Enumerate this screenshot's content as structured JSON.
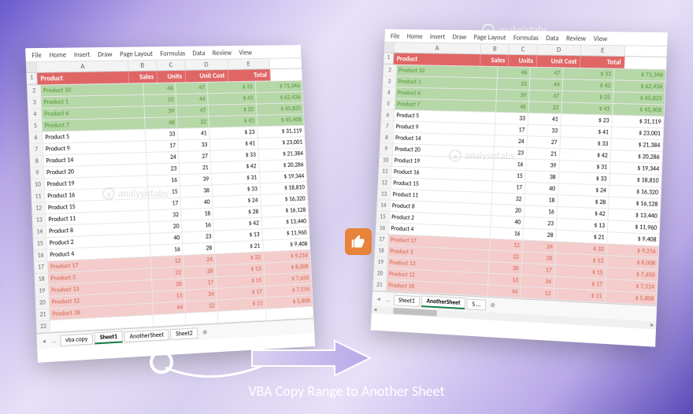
{
  "caption": "VBA Copy Range to Another Sheet",
  "watermark": "analysistabs",
  "ribbon_tabs": [
    "File",
    "Home",
    "Insert",
    "Draw",
    "Page Layout",
    "Formulas",
    "Data",
    "Review",
    "View"
  ],
  "col_letters": [
    "",
    "A",
    "B",
    "C",
    "D",
    "E"
  ],
  "header": {
    "product": "Product",
    "sales": "Sales",
    "units": "Units",
    "unitcost": "Unit Cost",
    "total": "Total"
  },
  "left": {
    "rows": [
      {
        "n": 2,
        "p": "Product 10",
        "s": 46,
        "u": 47,
        "c": "$   33",
        "t": "$   71,346",
        "cls": "g1"
      },
      {
        "n": 3,
        "p": "Product 1",
        "s": 33,
        "u": 44,
        "c": "$   43",
        "t": "$   62,436",
        "cls": "g1"
      },
      {
        "n": 4,
        "p": "Product 6",
        "s": 39,
        "u": 47,
        "c": "$   25",
        "t": "$   45,825",
        "cls": "g1"
      },
      {
        "n": 5,
        "p": "Product 7",
        "s": 48,
        "u": 22,
        "c": "$   43",
        "t": "$   45,408",
        "cls": "g1"
      },
      {
        "n": 6,
        "p": "Product 5",
        "s": 33,
        "u": 41,
        "c": "$   23",
        "t": "$   31,119",
        "cls": ""
      },
      {
        "n": 7,
        "p": "Product 9",
        "s": 17,
        "u": 33,
        "c": "$   41",
        "t": "$   23,001",
        "cls": ""
      },
      {
        "n": 8,
        "p": "Product 14",
        "s": 24,
        "u": 27,
        "c": "$   33",
        "t": "$   21,384",
        "cls": ""
      },
      {
        "n": 9,
        "p": "Product 20",
        "s": 23,
        "u": 21,
        "c": "$   42",
        "t": "$   20,286",
        "cls": ""
      },
      {
        "n": 10,
        "p": "Product 19",
        "s": 16,
        "u": 39,
        "c": "$   31",
        "t": "$   19,344",
        "cls": ""
      },
      {
        "n": 11,
        "p": "Product 16",
        "s": 15,
        "u": 38,
        "c": "$   33",
        "t": "$   18,810",
        "cls": ""
      },
      {
        "n": 12,
        "p": "Product 15",
        "s": 17,
        "u": 40,
        "c": "$   24",
        "t": "$   16,320",
        "cls": ""
      },
      {
        "n": 13,
        "p": "Product 11",
        "s": 32,
        "u": 18,
        "c": "$   28",
        "t": "$   16,128",
        "cls": ""
      },
      {
        "n": 14,
        "p": "Product 8",
        "s": 20,
        "u": 16,
        "c": "$   42",
        "t": "$   13,440",
        "cls": ""
      },
      {
        "n": 15,
        "p": "Product 2",
        "s": 40,
        "u": 23,
        "c": "$   13",
        "t": "$   11,960",
        "cls": ""
      },
      {
        "n": 16,
        "p": "Product 4",
        "s": 16,
        "u": 28,
        "c": "$   21",
        "t": "$    9,408",
        "cls": ""
      },
      {
        "n": 17,
        "p": "Product 17",
        "s": 12,
        "u": 24,
        "c": "$   32",
        "t": "$    9,216",
        "cls": "p1"
      },
      {
        "n": 18,
        "p": "Product 3",
        "s": 22,
        "u": 28,
        "c": "$   13",
        "t": "$    8,008",
        "cls": "p1"
      },
      {
        "n": 19,
        "p": "Product 13",
        "s": 30,
        "u": 17,
        "c": "$   15",
        "t": "$    7,650",
        "cls": "p1"
      },
      {
        "n": 20,
        "p": "Product 12",
        "s": 13,
        "u": 34,
        "c": "$   17",
        "t": "$    7,514",
        "cls": "p1"
      },
      {
        "n": 21,
        "p": "Product 18",
        "s": 44,
        "u": 12,
        "c": "$   11",
        "t": "$    5,808",
        "cls": "p1"
      },
      {
        "n": 22,
        "p": "",
        "s": "",
        "u": "",
        "c": "",
        "t": "",
        "cls": ""
      }
    ],
    "tabs": [
      "vba copy",
      "Sheet1",
      "AnotherSheet",
      "Sheet2"
    ],
    "active_tab": "Sheet1"
  },
  "right": {
    "rows": [
      {
        "n": 2,
        "p": "Product 10",
        "s": 46,
        "u": 47,
        "c": "$   33",
        "t": "$   71,346",
        "cls": "g1"
      },
      {
        "n": 3,
        "p": "Product 1",
        "s": 33,
        "u": 44,
        "c": "$   43",
        "t": "$   62,436",
        "cls": "g1"
      },
      {
        "n": 4,
        "p": "Product 6",
        "s": 39,
        "u": 47,
        "c": "$   25",
        "t": "$   45,825",
        "cls": "g1"
      },
      {
        "n": 5,
        "p": "Product 7",
        "s": 48,
        "u": 22,
        "c": "$   43",
        "t": "$   45,408",
        "cls": "g1"
      },
      {
        "n": 6,
        "p": "Product 5",
        "s": 33,
        "u": 41,
        "c": "$   23",
        "t": "$   31,119",
        "cls": ""
      },
      {
        "n": 7,
        "p": "Product 9",
        "s": 17,
        "u": 33,
        "c": "$   41",
        "t": "$   23,001",
        "cls": ""
      },
      {
        "n": 8,
        "p": "Product 14",
        "s": 24,
        "u": 27,
        "c": "$   33",
        "t": "$   21,384",
        "cls": ""
      },
      {
        "n": 9,
        "p": "Product 20",
        "s": 23,
        "u": 21,
        "c": "$   42",
        "t": "$   20,286",
        "cls": ""
      },
      {
        "n": 10,
        "p": "Product 19",
        "s": 16,
        "u": 39,
        "c": "$   31",
        "t": "$   19,344",
        "cls": ""
      },
      {
        "n": 11,
        "p": "Product 16",
        "s": 15,
        "u": 38,
        "c": "$   33",
        "t": "$   18,810",
        "cls": ""
      },
      {
        "n": 12,
        "p": "Product 15",
        "s": 17,
        "u": 40,
        "c": "$   24",
        "t": "$   16,320",
        "cls": ""
      },
      {
        "n": 13,
        "p": "Product 11",
        "s": 32,
        "u": 18,
        "c": "$   28",
        "t": "$   16,128",
        "cls": ""
      },
      {
        "n": 14,
        "p": "Product 8",
        "s": 20,
        "u": 16,
        "c": "$   42",
        "t": "$   13,440",
        "cls": ""
      },
      {
        "n": 15,
        "p": "Product 2",
        "s": 40,
        "u": 23,
        "c": "$   13",
        "t": "$   11,960",
        "cls": ""
      },
      {
        "n": 16,
        "p": "Product 4",
        "s": 16,
        "u": 28,
        "c": "$   21",
        "t": "$    9,408",
        "cls": ""
      },
      {
        "n": 17,
        "p": "Product 17",
        "s": 12,
        "u": 24,
        "c": "$   32",
        "t": "$    9,216",
        "cls": "p1"
      },
      {
        "n": 18,
        "p": "Product 3",
        "s": 22,
        "u": 28,
        "c": "$   13",
        "t": "$    8,008",
        "cls": "p1"
      },
      {
        "n": 19,
        "p": "Product 13",
        "s": 30,
        "u": 17,
        "c": "$   15",
        "t": "$    7,650",
        "cls": "p1"
      },
      {
        "n": 20,
        "p": "Product 12",
        "s": 13,
        "u": 34,
        "c": "$   17",
        "t": "$    7,514",
        "cls": "p1"
      },
      {
        "n": 21,
        "p": "Product 18",
        "s": 44,
        "u": 12,
        "c": "$   11",
        "t": "$    5,808",
        "cls": "p1"
      }
    ],
    "tabs": [
      "Sheet1",
      "AnotherSheet",
      "S ..."
    ],
    "active_tab": "AnotherSheet"
  },
  "chart_data": {
    "type": "table",
    "title": "VBA Copy Range to Another Sheet — source & destination tables (identical data)",
    "columns": [
      "Product",
      "Sales",
      "Units",
      "Unit Cost",
      "Total"
    ],
    "rows": [
      [
        "Product 10",
        46,
        47,
        33,
        71346
      ],
      [
        "Product 1",
        33,
        44,
        43,
        62436
      ],
      [
        "Product 6",
        39,
        47,
        25,
        45825
      ],
      [
        "Product 7",
        48,
        22,
        43,
        45408
      ],
      [
        "Product 5",
        33,
        41,
        23,
        31119
      ],
      [
        "Product 9",
        17,
        33,
        41,
        23001
      ],
      [
        "Product 14",
        24,
        27,
        33,
        21384
      ],
      [
        "Product 20",
        23,
        21,
        42,
        20286
      ],
      [
        "Product 19",
        16,
        39,
        31,
        19344
      ],
      [
        "Product 16",
        15,
        38,
        33,
        18810
      ],
      [
        "Product 15",
        17,
        40,
        24,
        16320
      ],
      [
        "Product 11",
        32,
        18,
        28,
        16128
      ],
      [
        "Product 8",
        20,
        16,
        42,
        13440
      ],
      [
        "Product 2",
        40,
        23,
        13,
        11960
      ],
      [
        "Product 4",
        16,
        28,
        21,
        9408
      ],
      [
        "Product 17",
        12,
        24,
        32,
        9216
      ],
      [
        "Product 3",
        22,
        28,
        13,
        8008
      ],
      [
        "Product 13",
        30,
        17,
        15,
        7650
      ],
      [
        "Product 12",
        13,
        34,
        17,
        7514
      ],
      [
        "Product 18",
        44,
        12,
        11,
        5808
      ]
    ]
  }
}
